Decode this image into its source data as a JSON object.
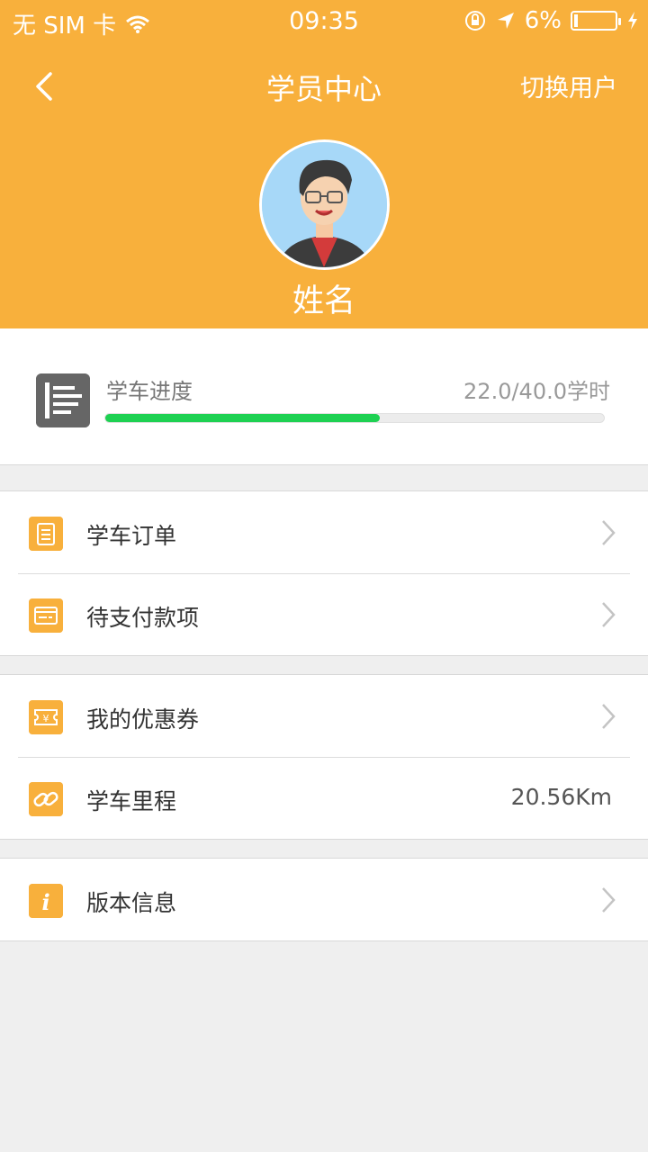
{
  "status_bar": {
    "carrier": "无 SIM 卡",
    "time": "09:35",
    "battery": "6%"
  },
  "nav": {
    "title": "学员中心",
    "switch_user": "切换用户"
  },
  "profile": {
    "name": "姓名"
  },
  "progress": {
    "label": "学车进度",
    "hours": "22.0/40.0学时",
    "fraction": 0.55
  },
  "menu": {
    "orders": "学车订单",
    "pending_payment": "待支付款项",
    "coupons": "我的优惠券",
    "mileage": "学车里程",
    "mileage_value": "20.56Km",
    "version": "版本信息"
  },
  "colors": {
    "accent": "#f8b03c",
    "progress": "#1ed152"
  }
}
